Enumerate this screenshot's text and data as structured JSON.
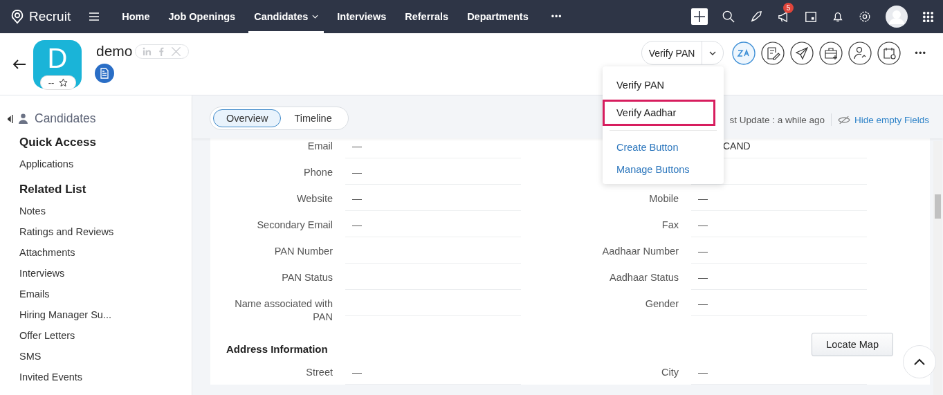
{
  "nav": {
    "brand": "Recruit",
    "items": [
      {
        "label": "Home",
        "selected": false,
        "has_menu": false
      },
      {
        "label": "Job Openings",
        "selected": false,
        "has_menu": false
      },
      {
        "label": "Candidates",
        "selected": true,
        "has_menu": true
      },
      {
        "label": "Interviews",
        "selected": false,
        "has_menu": false
      },
      {
        "label": "Referrals",
        "selected": false,
        "has_menu": false
      },
      {
        "label": "Departments",
        "selected": false,
        "has_menu": false
      }
    ],
    "more": "•••",
    "notification_count": "5"
  },
  "record": {
    "initial": "D",
    "rating": "--",
    "name": "demo",
    "split_button": "Verify PAN",
    "more": "•••"
  },
  "sidebar": {
    "module": "Candidates",
    "sections": [
      {
        "title": "Quick Access",
        "items": [
          "Applications"
        ]
      },
      {
        "title": "Related List",
        "items": [
          "Notes",
          "Ratings and Reviews",
          "Attachments",
          "Interviews",
          "Emails",
          "Hiring Manager Su...",
          "Offer Letters",
          "SMS",
          "Invited Events"
        ]
      }
    ]
  },
  "view_tabs": [
    {
      "label": "Overview",
      "selected": true
    },
    {
      "label": "Timeline",
      "selected": false
    }
  ],
  "last_update": "st Update : a while ago",
  "hide_empty": "Hide empty Fields",
  "fields": [
    {
      "left": {
        "label": "Email",
        "value": "—"
      },
      "right": {
        "value": "CAND"
      }
    },
    {
      "left": {
        "label": "Phone",
        "value": "—"
      }
    },
    {
      "left": {
        "label": "Website",
        "value": "—"
      },
      "right": {
        "label": "Mobile",
        "value": "—"
      }
    },
    {
      "left": {
        "label": "Secondary Email",
        "value": "—"
      },
      "right": {
        "label": "Fax",
        "value": "—"
      }
    },
    {
      "left": {
        "label": "PAN Number"
      },
      "right": {
        "label": "Aadhaar Number",
        "value": "—"
      }
    },
    {
      "left": {
        "label": "PAN Status"
      },
      "right": {
        "label": "Aadhaar Status",
        "value": "—"
      }
    },
    {
      "left": {
        "label": "Name associated with PAN"
      },
      "right": {
        "label": "Gender",
        "value": "—"
      }
    }
  ],
  "address": {
    "title": "Address Information",
    "button": "Locate Map",
    "fields": [
      {
        "left": {
          "label": "Street",
          "value": "—"
        },
        "right": {
          "label": "City",
          "value": "—"
        }
      }
    ]
  },
  "dropdown": {
    "actions": [
      {
        "label": "Verify PAN",
        "highlighted": false
      },
      {
        "label": "Verify Aadhar",
        "highlighted": true
      }
    ],
    "links": [
      "Create Button",
      "Manage Buttons"
    ]
  }
}
